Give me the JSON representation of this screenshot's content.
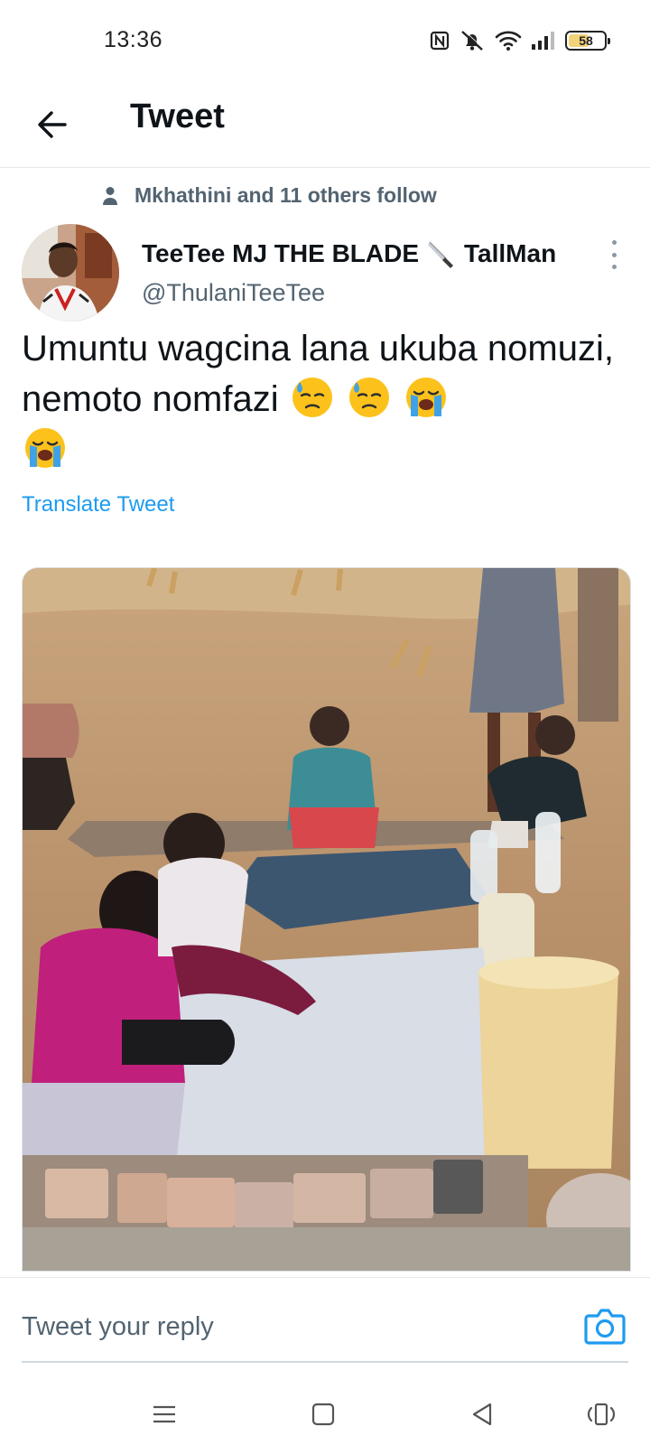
{
  "status_bar": {
    "time": "13:36",
    "battery": "58",
    "battery_level": 0.58,
    "icons": [
      "nfc-icon",
      "mute-icon",
      "wifi-icon",
      "signal-icon",
      "battery-icon"
    ]
  },
  "header": {
    "title": "Tweet",
    "back_icon": "arrow-left-icon"
  },
  "social_context": {
    "text": "Mkhathini and 11 others follow",
    "icon": "person-icon"
  },
  "tweet": {
    "author_name_part1": "TeeTee MJ THE BLADE",
    "author_name_emoji": "knife",
    "author_name_part2": "TallMan",
    "author_handle": "@ThulaniTeeTee",
    "text": "Umuntu wagcina lana ukuba nomuzi, nemoto nomfazi",
    "trailing_emojis": [
      "downcast-face-with-sweat",
      "downcast-face-with-sweat",
      "loudly-crying-face",
      "loudly-crying-face"
    ],
    "translate_label": "Translate Tweet",
    "media_description_icon": "photo"
  },
  "reply": {
    "placeholder": "Tweet your reply",
    "camera_icon": "camera-icon"
  },
  "colors": {
    "accent": "#1d9bf0",
    "secondary_text": "#536471",
    "primary_text": "#0f1419"
  },
  "nav": {
    "icons": [
      "menu-icon",
      "home-square-icon",
      "back-triangle-icon",
      "rotate-icon"
    ]
  }
}
